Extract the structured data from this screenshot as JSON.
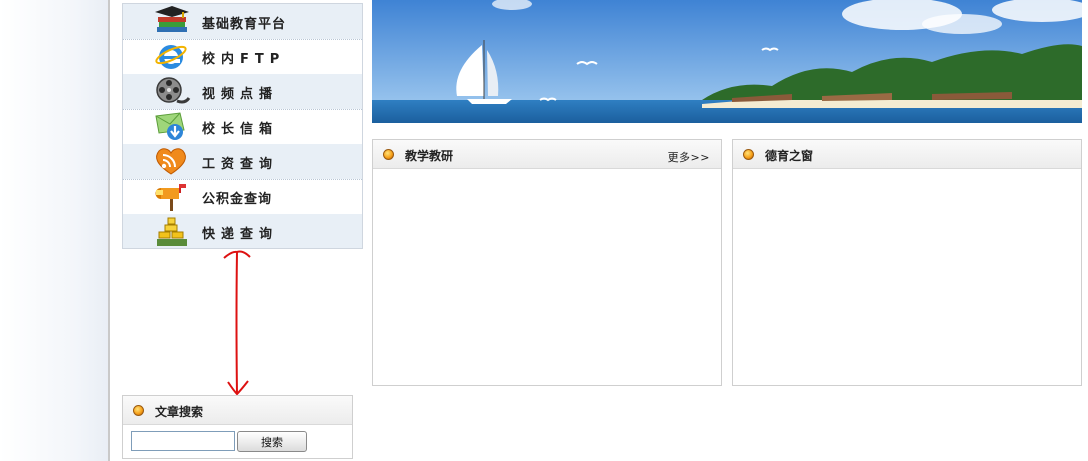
{
  "menu": {
    "items": [
      {
        "label": "基础教育平台",
        "icon": "books-graduation-cap-icon"
      },
      {
        "label": "校内FTP",
        "icon": "internet-explorer-icon"
      },
      {
        "label": "视频点播",
        "icon": "film-reel-icon"
      },
      {
        "label": "校长信箱",
        "icon": "mail-download-icon"
      },
      {
        "label": "工资查询",
        "icon": "rss-heart-icon"
      },
      {
        "label": "公积金查询",
        "icon": "mailbox-icon"
      },
      {
        "label": "快递查询",
        "icon": "gold-bars-icon"
      }
    ]
  },
  "panels": {
    "teaching": {
      "title": "教学教研",
      "more": "更多>>"
    },
    "moral": {
      "title": "德育之窗"
    }
  },
  "search": {
    "title": "文章搜索",
    "input_value": "",
    "button_label": "搜索"
  },
  "colors": {
    "annotation_arrow": "#dd1111",
    "menu_shade": "#e8eff6",
    "border": "#cfd6df"
  }
}
